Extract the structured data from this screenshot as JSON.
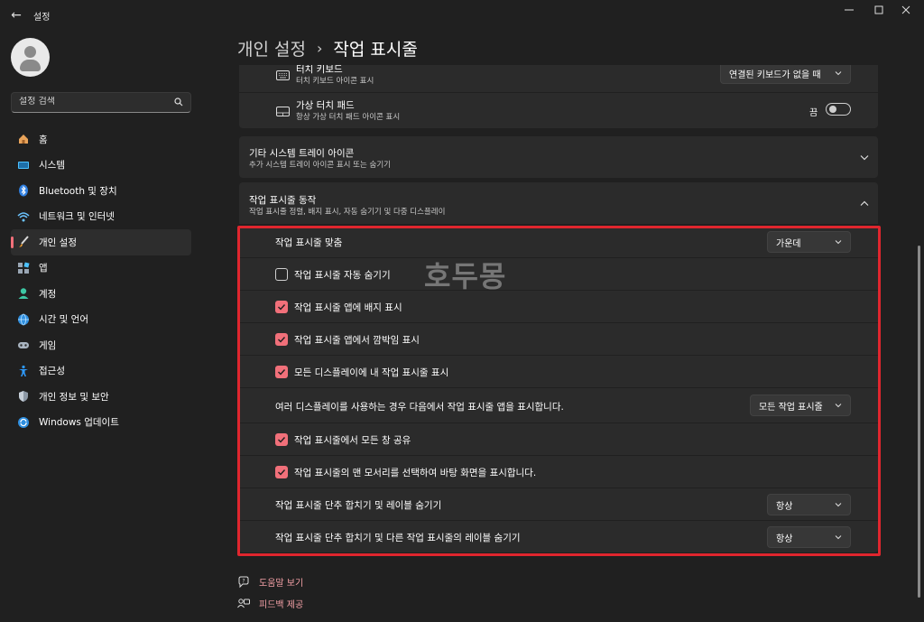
{
  "window": {
    "app_title": "설정",
    "back_glyph": "←",
    "minimize_glyph": "—",
    "maximize_glyph": "☐",
    "close_glyph": "✕"
  },
  "search": {
    "placeholder": "설정 검색"
  },
  "sidebar": {
    "items": [
      {
        "label": "홈",
        "icon": "home-icon"
      },
      {
        "label": "시스템",
        "icon": "system-icon"
      },
      {
        "label": "Bluetooth 및 장치",
        "icon": "bluetooth-icon"
      },
      {
        "label": "네트워크 및 인터넷",
        "icon": "network-icon"
      },
      {
        "label": "개인 설정",
        "icon": "personalization-brush-icon",
        "active": true
      },
      {
        "label": "앱",
        "icon": "apps-icon"
      },
      {
        "label": "계정",
        "icon": "account-icon"
      },
      {
        "label": "시간 및 언어",
        "icon": "time-language-icon"
      },
      {
        "label": "게임",
        "icon": "gaming-icon"
      },
      {
        "label": "접근성",
        "icon": "accessibility-icon"
      },
      {
        "label": "개인 정보 및 보안",
        "icon": "privacy-shield-icon"
      },
      {
        "label": "Windows 업데이트",
        "icon": "windows-update-icon"
      }
    ]
  },
  "header": {
    "parent": "개인 설정",
    "separator": "›",
    "current": "작업 표시줄"
  },
  "pen_touch": {
    "touch_keyboard_title": "터치 키보드",
    "touch_keyboard_sub": "터치 키보드 아이콘 표시",
    "touch_keyboard_value": "연결된 키보드가 없을 때",
    "touchpad_title": "가상 터치 패드",
    "touchpad_sub": "항상 가상 터치 패드 아이콘 표시",
    "touchpad_state": "끔"
  },
  "other_tray": {
    "title": "기타 시스템 트레이 아이콘",
    "sub": "추가 시스템 트레이 아이콘 표시 또는 숨기기"
  },
  "behaviors": {
    "title": "작업 표시줄 동작",
    "sub": "작업 표시줄 정렬, 배지 표시, 자동 숨기기 및 다중 디스플레이",
    "alignment_label": "작업 표시줄 맞춤",
    "alignment_value": "가운데",
    "auto_hide_label": "작업 표시줄 자동 숨기기",
    "auto_hide_checked": false,
    "badges_label": "작업 표시줄 앱에 배지 표시",
    "badges_checked": true,
    "flashing_label": "작업 표시줄 앱에서 깜박임 표시",
    "flashing_checked": true,
    "all_displays_label": "모든 디스플레이에 내 작업 표시줄 표시",
    "all_displays_checked": true,
    "multi_display_label": "여러 디스플레이를 사용하는 경우 다음에서 작업 표시줄 앱을 표시합니다.",
    "multi_display_value": "모든 작업 표시줄",
    "share_window_label": "작업 표시줄에서 모든 창 공유",
    "share_window_checked": true,
    "far_corner_label": "작업 표시줄의 맨 모서리를 선택하여 바탕 화면을 표시합니다.",
    "far_corner_checked": true,
    "combine_label": "작업 표시줄 단추 합치기 및 레이블 숨기기",
    "combine_value": "항상",
    "combine_other_label": "작업 표시줄 단추 합치기 및 다른 작업 표시줄의 레이블 숨기기",
    "combine_other_value": "항상"
  },
  "watermark": "호두몽",
  "footer": {
    "help": "도움말 보기",
    "feedback": "피드백 제공"
  },
  "colors": {
    "accent": "#f1707a",
    "highlight_box": "#e0262e",
    "background": "#202020",
    "card": "#2b2b2b"
  }
}
